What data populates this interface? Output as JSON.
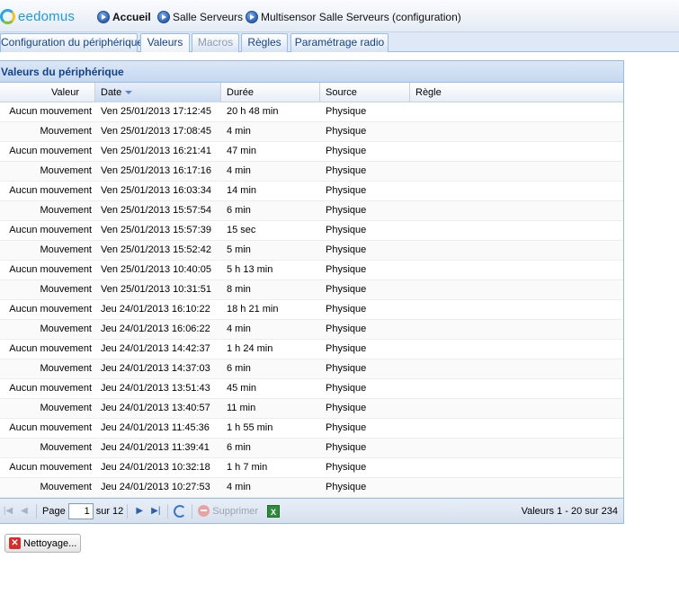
{
  "header": {
    "logo_text": "eedomus",
    "breadcrumb": [
      "Accueil",
      "Salle Serveurs",
      "Multisensor Salle Serveurs (configuration)"
    ]
  },
  "tabs": [
    {
      "label": "Configuration du périphérique",
      "state": "normal"
    },
    {
      "label": "Valeurs",
      "state": "active"
    },
    {
      "label": "Macros",
      "state": "disabled"
    },
    {
      "label": "Règles",
      "state": "normal"
    },
    {
      "label": "Paramétrage radio",
      "state": "normal"
    }
  ],
  "panel": {
    "title": "Valeurs du périphérique",
    "columns": [
      "Valeur",
      "Date",
      "Durée",
      "Source",
      "Règle"
    ],
    "sorted_column": "Date",
    "rows": [
      [
        "Aucun mouvement",
        "Ven 25/01/2013 17:12:45",
        "20 h 48 min",
        "Physique",
        ""
      ],
      [
        "Mouvement",
        "Ven 25/01/2013 17:08:45",
        "4 min",
        "Physique",
        ""
      ],
      [
        "Aucun mouvement",
        "Ven 25/01/2013 16:21:41",
        "47 min",
        "Physique",
        ""
      ],
      [
        "Mouvement",
        "Ven 25/01/2013 16:17:16",
        "4 min",
        "Physique",
        ""
      ],
      [
        "Aucun mouvement",
        "Ven 25/01/2013 16:03:34",
        "14 min",
        "Physique",
        ""
      ],
      [
        "Mouvement",
        "Ven 25/01/2013 15:57:54",
        "6 min",
        "Physique",
        ""
      ],
      [
        "Aucun mouvement",
        "Ven 25/01/2013 15:57:39",
        "15 sec",
        "Physique",
        ""
      ],
      [
        "Mouvement",
        "Ven 25/01/2013 15:52:42",
        "5 min",
        "Physique",
        ""
      ],
      [
        "Aucun mouvement",
        "Ven 25/01/2013 10:40:05",
        "5 h 13 min",
        "Physique",
        ""
      ],
      [
        "Mouvement",
        "Ven 25/01/2013 10:31:51",
        "8 min",
        "Physique",
        ""
      ],
      [
        "Aucun mouvement",
        "Jeu 24/01/2013 16:10:22",
        "18 h 21 min",
        "Physique",
        ""
      ],
      [
        "Mouvement",
        "Jeu 24/01/2013 16:06:22",
        "4 min",
        "Physique",
        ""
      ],
      [
        "Aucun mouvement",
        "Jeu 24/01/2013 14:42:37",
        "1 h 24 min",
        "Physique",
        ""
      ],
      [
        "Mouvement",
        "Jeu 24/01/2013 14:37:03",
        "6 min",
        "Physique",
        ""
      ],
      [
        "Aucun mouvement",
        "Jeu 24/01/2013 13:51:43",
        "45 min",
        "Physique",
        ""
      ],
      [
        "Mouvement",
        "Jeu 24/01/2013 13:40:57",
        "11 min",
        "Physique",
        ""
      ],
      [
        "Aucun mouvement",
        "Jeu 24/01/2013 11:45:36",
        "1 h 55 min",
        "Physique",
        ""
      ],
      [
        "Mouvement",
        "Jeu 24/01/2013 11:39:41",
        "6 min",
        "Physique",
        ""
      ],
      [
        "Aucun mouvement",
        "Jeu 24/01/2013 10:32:18",
        "1 h 7 min",
        "Physique",
        ""
      ],
      [
        "Mouvement",
        "Jeu 24/01/2013 10:27:53",
        "4 min",
        "Physique",
        ""
      ]
    ]
  },
  "pager": {
    "page_label": "Page",
    "page_value": "1",
    "total_label": "sur 12",
    "delete_label": "Supprimer",
    "info": "Valeurs 1 - 20 sur 234"
  },
  "actions": {
    "cleanup_label": "Nettoyage..."
  },
  "colors": {
    "brand": "#1e9ad8",
    "panel_title": "#15428b",
    "border": "#99bbe8"
  }
}
